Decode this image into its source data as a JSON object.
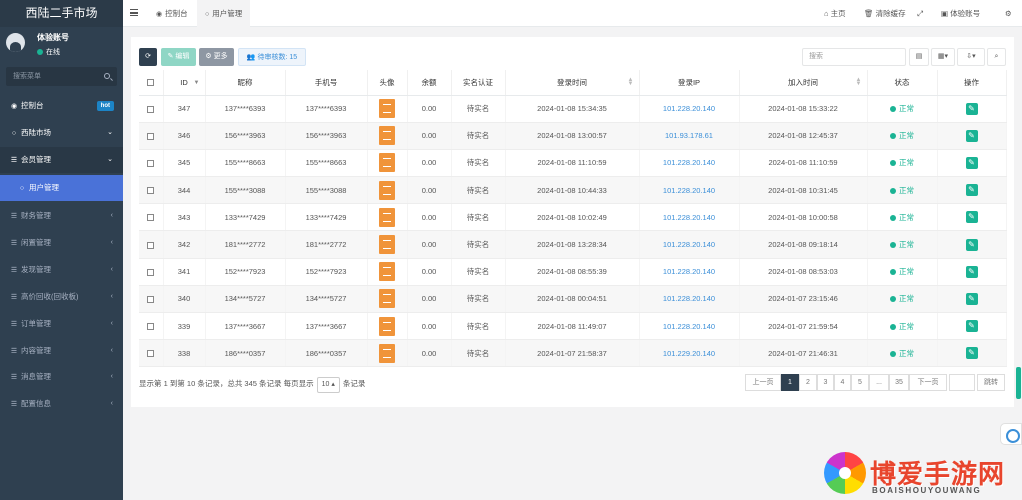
{
  "brand": "西陆二手市场",
  "user": {
    "name": "体验账号",
    "status": "在线"
  },
  "sidebar": {
    "search_placeholder": "搜索菜单",
    "items": [
      {
        "label": "控制台",
        "badge": "hot"
      },
      {
        "label": "西陆市场"
      },
      {
        "label": "会员管理"
      },
      {
        "label": "用户管理"
      },
      {
        "label": "财务管理"
      },
      {
        "label": "闲置管理"
      },
      {
        "label": "发现管理"
      },
      {
        "label": "高价回收(回收板)"
      },
      {
        "label": "订单管理"
      },
      {
        "label": "内容管理"
      },
      {
        "label": "消息管理"
      },
      {
        "label": "配置信息"
      }
    ]
  },
  "tabs": [
    {
      "label": "控制台"
    },
    {
      "label": "用户管理"
    }
  ],
  "topright": {
    "home": "主页",
    "clear": "清除缓存",
    "account": "体验账号"
  },
  "toolbar": {
    "edit": "编辑",
    "more": "更多",
    "pending_label": "待审核数:",
    "pending_count": "15",
    "search_placeholder": "搜索"
  },
  "columns": [
    "ID",
    "昵称",
    "手机号",
    "头像",
    "余额",
    "实名认证",
    "登录时间",
    "登录IP",
    "加入时间",
    "状态",
    "操作"
  ],
  "rows": [
    {
      "id": "347",
      "nick": "137****6393",
      "phone": "137****6393",
      "balance": "0.00",
      "verify": "待实名",
      "login_time": "2024-01-08 15:34:35",
      "ip": "101.228.20.140",
      "join_time": "2024-01-08 15:33:22",
      "status": "正常"
    },
    {
      "id": "346",
      "nick": "156****3963",
      "phone": "156****3963",
      "balance": "0.00",
      "verify": "待实名",
      "login_time": "2024-01-08 13:00:57",
      "ip": "101.93.178.61",
      "join_time": "2024-01-08 12:45:37",
      "status": "正常"
    },
    {
      "id": "345",
      "nick": "155****8663",
      "phone": "155****8663",
      "balance": "0.00",
      "verify": "待实名",
      "login_time": "2024-01-08 11:10:59",
      "ip": "101.228.20.140",
      "join_time": "2024-01-08 11:10:59",
      "status": "正常"
    },
    {
      "id": "344",
      "nick": "155****3088",
      "phone": "155****3088",
      "balance": "0.00",
      "verify": "待实名",
      "login_time": "2024-01-08 10:44:33",
      "ip": "101.228.20.140",
      "join_time": "2024-01-08 10:31:45",
      "status": "正常"
    },
    {
      "id": "343",
      "nick": "133****7429",
      "phone": "133****7429",
      "balance": "0.00",
      "verify": "待实名",
      "login_time": "2024-01-08 10:02:49",
      "ip": "101.228.20.140",
      "join_time": "2024-01-08 10:00:58",
      "status": "正常"
    },
    {
      "id": "342",
      "nick": "181****2772",
      "phone": "181****2772",
      "balance": "0.00",
      "verify": "待实名",
      "login_time": "2024-01-08 13:28:34",
      "ip": "101.228.20.140",
      "join_time": "2024-01-08 09:18:14",
      "status": "正常"
    },
    {
      "id": "341",
      "nick": "152****7923",
      "phone": "152****7923",
      "balance": "0.00",
      "verify": "待实名",
      "login_time": "2024-01-08 08:55:39",
      "ip": "101.228.20.140",
      "join_time": "2024-01-08 08:53:03",
      "status": "正常"
    },
    {
      "id": "340",
      "nick": "134****5727",
      "phone": "134****5727",
      "balance": "0.00",
      "verify": "待实名",
      "login_time": "2024-01-08 00:04:51",
      "ip": "101.228.20.140",
      "join_time": "2024-01-07 23:15:46",
      "status": "正常"
    },
    {
      "id": "339",
      "nick": "137****3667",
      "phone": "137****3667",
      "balance": "0.00",
      "verify": "待实名",
      "login_time": "2024-01-08 11:49:07",
      "ip": "101.228.20.140",
      "join_time": "2024-01-07 21:59:54",
      "status": "正常"
    },
    {
      "id": "338",
      "nick": "186****0357",
      "phone": "186****0357",
      "balance": "0.00",
      "verify": "待实名",
      "login_time": "2024-01-07 21:58:37",
      "ip": "101.229.20.140",
      "join_time": "2024-01-07 21:46:31",
      "status": "正常"
    }
  ],
  "pagination": {
    "info": "显示第 1 到第 10 条记录，总共 345 条记录 每页显示",
    "per_page": "10",
    "suffix": "条记录",
    "prev": "上一页",
    "pages": [
      "1",
      "2",
      "3",
      "4",
      "5",
      "...",
      "35"
    ],
    "next": "下一页",
    "jump": "跳转"
  },
  "watermark": {
    "title": "博爱手游网",
    "subtitle": "BOAISHOUYOUWANG"
  }
}
